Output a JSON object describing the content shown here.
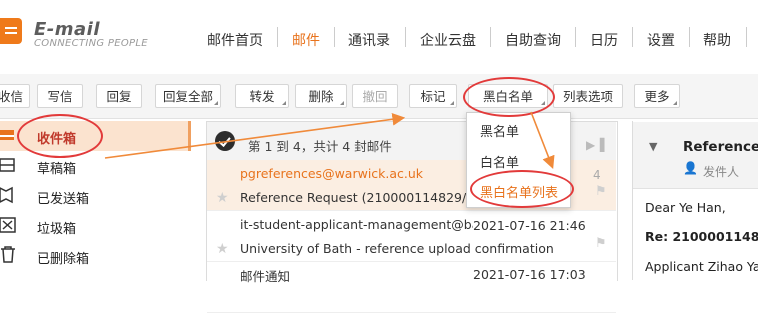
{
  "header": {
    "logo_title": "E-mail",
    "logo_subtitle": "CONNECTING PEOPLE",
    "nav": [
      {
        "label": "邮件首页",
        "active": false
      },
      {
        "label": "邮件",
        "active": true
      },
      {
        "label": "通讯录",
        "active": false
      },
      {
        "label": "企业云盘",
        "active": false
      },
      {
        "label": "自助查询",
        "active": false
      },
      {
        "label": "日历",
        "active": false
      },
      {
        "label": "设置",
        "active": false
      },
      {
        "label": "帮助",
        "active": false
      }
    ],
    "accent_color": "#e8731d"
  },
  "toolbar": {
    "receive": "收信",
    "compose": "写信",
    "reply": "回复",
    "reply_all": "回复全部",
    "forward": "转发",
    "delete": "删除",
    "undo": "撤回",
    "mark": "标记",
    "blacklist": "黑白名单",
    "list_options": "列表选项",
    "more": "更多"
  },
  "dropdown": {
    "items": [
      "黑名单",
      "白名单",
      "黑白名单列表"
    ]
  },
  "sidebar": {
    "items": [
      {
        "label": "收件箱",
        "icon": "inbox-icon",
        "active": true
      },
      {
        "label": "草稿箱",
        "icon": "drafts-icon",
        "active": false
      },
      {
        "label": "已发送箱",
        "icon": "sent-icon",
        "active": false
      },
      {
        "label": "垃圾箱",
        "icon": "spam-icon",
        "active": false
      },
      {
        "label": "已删除箱",
        "icon": "trash-icon",
        "active": false
      }
    ]
  },
  "list": {
    "count_text": "第 1 到 4，共计 4 封邮件",
    "pager_fragment": "4",
    "rows": [
      {
        "sender": "pgreferences@warwick.ac.uk",
        "subject": "Reference Request (210000114829/219",
        "date": "",
        "selected": true
      },
      {
        "sender": "it-student-applicant-management@bath",
        "subject": "University of Bath - reference upload confirmation",
        "date": "2021-07-16 21:46",
        "selected": false
      },
      {
        "sender": "邮件通知",
        "subject": "",
        "date": "2021-07-16 17:03",
        "selected": false
      }
    ]
  },
  "reader": {
    "title": "Reference R",
    "from_label": "发件人",
    "lines": [
      "Dear Ye Han,",
      "Re: 210000114829/",
      "Applicant Zihao Yan"
    ]
  }
}
